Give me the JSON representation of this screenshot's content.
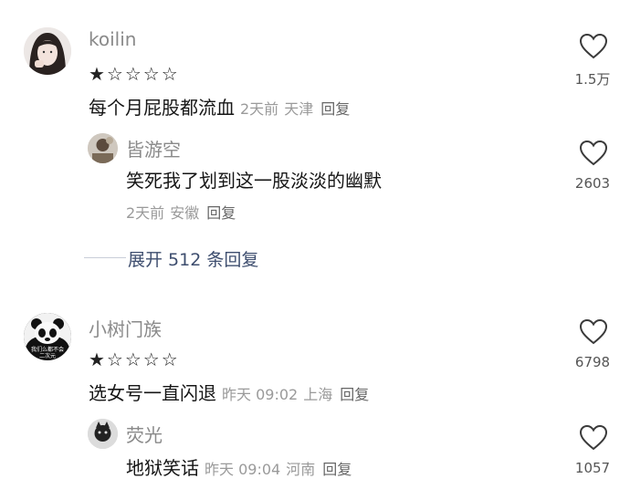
{
  "comments": [
    {
      "username": "koilin",
      "stars": "★☆☆☆☆",
      "text": "每个月屁股都流血",
      "time": "2天前",
      "location": "天津",
      "reply": "回复",
      "likes": "1.5万",
      "replies": [
        {
          "username": "皆游空",
          "text": "笑死我了划到这一股淡淡的幽默",
          "time": "2天前",
          "location": "安徽",
          "reply": "回复",
          "likes": "2603"
        }
      ],
      "expand_label": "展开 512 条回复"
    },
    {
      "username": "小树门族",
      "stars": "★☆☆☆☆",
      "text": "选女号一直闪退",
      "time": "昨天 09:02",
      "location": "上海",
      "reply": "回复",
      "likes": "6798",
      "avatar_text": "我们么都不会二次元",
      "replies": [
        {
          "username": "荧光",
          "text": "地狱笑话",
          "time": "昨天 09:04",
          "location": "河南",
          "reply": "回复",
          "likes": "1057"
        }
      ]
    }
  ]
}
